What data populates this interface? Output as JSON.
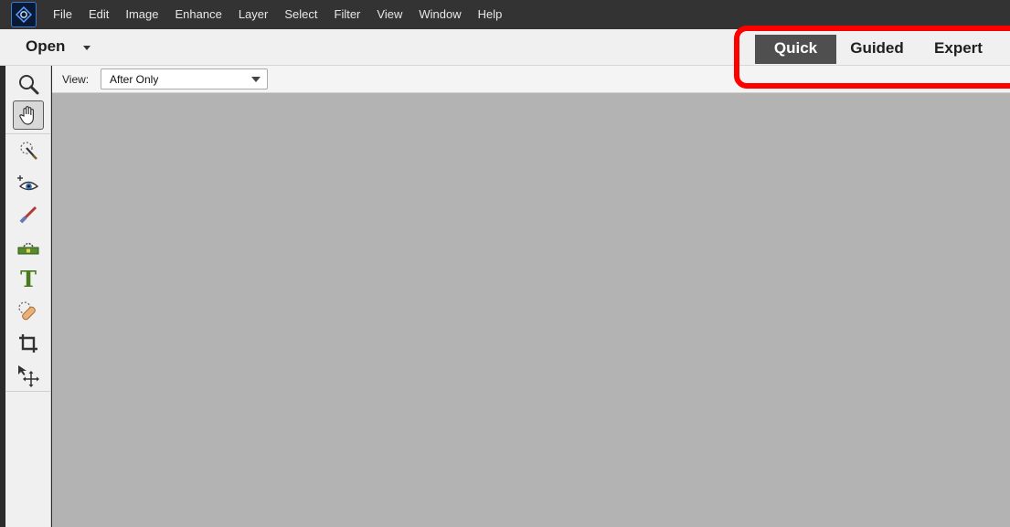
{
  "menubar": {
    "logo_icon": "photoshop-elements-logo-icon",
    "items": [
      "File",
      "Edit",
      "Image",
      "Enhance",
      "Layer",
      "Select",
      "Filter",
      "View",
      "Window",
      "Help"
    ]
  },
  "modebar": {
    "open_label": "Open",
    "tabs": [
      {
        "label": "Quick",
        "active": true
      },
      {
        "label": "Guided",
        "active": false
      },
      {
        "label": "Expert",
        "active": false
      }
    ],
    "highlight_color": "#ff0000"
  },
  "options": {
    "view_label": "View:",
    "view_value": "After Only"
  },
  "toolbar": {
    "tools": [
      "zoom-icon",
      "hand-icon",
      "quick-selection-icon",
      "red-eye-icon",
      "whiten-teeth-icon",
      "straighten-icon",
      "type-icon",
      "spot-healing-icon",
      "crop-icon",
      "move-icon"
    ],
    "selected": "hand-icon"
  },
  "canvas": {
    "background": "#b3b3b3"
  }
}
